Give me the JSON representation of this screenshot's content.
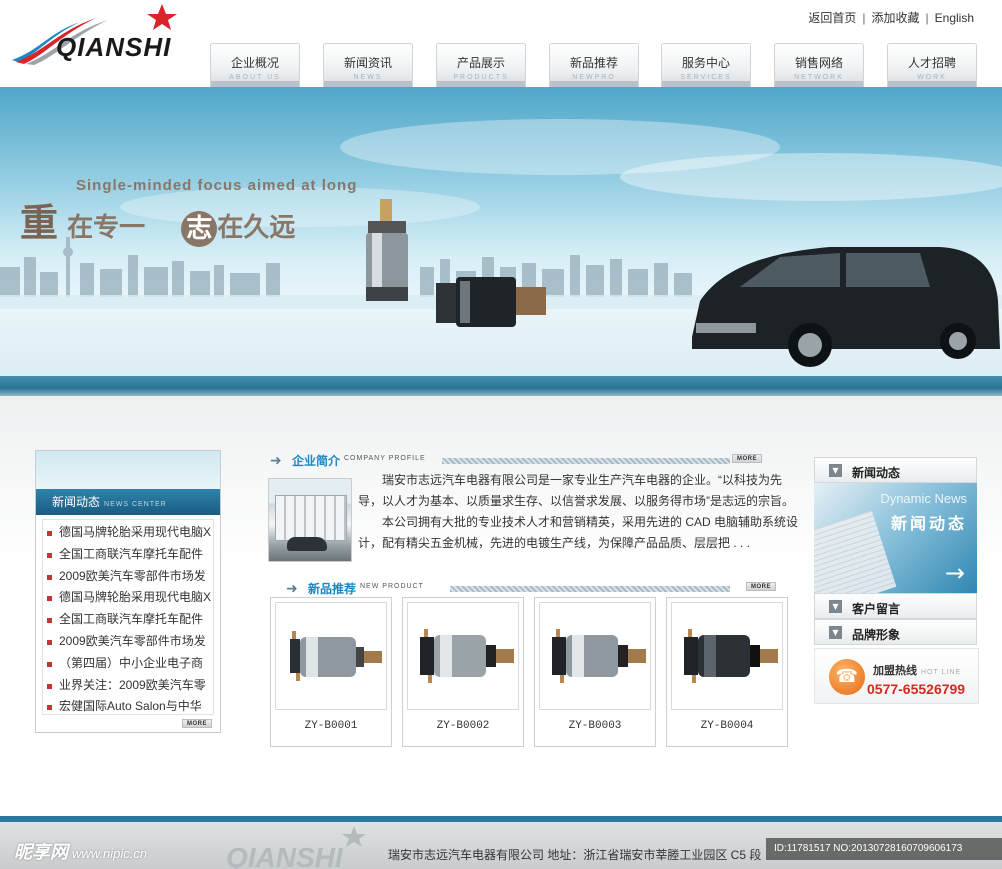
{
  "header": {
    "logo_text": "QIANSHI",
    "top_links": [
      "返回首页",
      "添加收藏",
      "English"
    ],
    "top_link_sep": "|"
  },
  "nav": [
    {
      "cn": "企业概况",
      "en": "ABOUT US"
    },
    {
      "cn": "新闻资讯",
      "en": "NEWS"
    },
    {
      "cn": "产品展示",
      "en": "PRODUCTS"
    },
    {
      "cn": "新品推荐",
      "en": "NEWPRO"
    },
    {
      "cn": "服务中心",
      "en": "SERVICES"
    },
    {
      "cn": "销售网络",
      "en": "NETWORK"
    },
    {
      "cn": "人才招聘",
      "en": "WORK"
    }
  ],
  "banner": {
    "slogan_en": "Single-minded focus aimed at long",
    "slogan_cn_1_big": "重",
    "slogan_cn_1": "在专一",
    "slogan_cn_2_big": "志",
    "slogan_cn_2": "在久远"
  },
  "news_box": {
    "title_cn": "新闻动态",
    "title_en": "NEWS CENTER",
    "items": [
      "德国马牌轮胎采用现代电脑X",
      "全国工商联汽车摩托车配件",
      "2009欧美汽车零部件市场发",
      "德国马牌轮胎采用现代电脑X",
      "全国工商联汽车摩托车配件",
      "2009欧美汽车零部件市场发",
      "（第四届）中小企业电子商",
      "业界关注：2009欧美汽车零",
      "宏健国际Auto Salon与中华"
    ],
    "more": "MORE"
  },
  "company": {
    "title_cn": "企业简介",
    "title_en": "COMPANY PROFILE",
    "more": "MORE",
    "para1": "瑞安市志远汽车电器有限公司是一家专业生产汽车电器的企业。“以科技为先导，以人才为基本、以质量求生存、以信誉求发展、以服务得市场”是志远的宗旨。",
    "para2": "本公司拥有大批的专业技术人才和营销精英，采用先进的 CAD 电脑辅助系统设计，配有精尖五金机械，先进的电镀生产线，为保障产品品质、层层把 . . ."
  },
  "new_products": {
    "title_cn": "新品推荐",
    "title_en": "NEW PRODUCT",
    "more": "MORE",
    "items": [
      "ZY-B0001",
      "ZY-B0002",
      "ZY-B0003",
      "ZY-B0004"
    ]
  },
  "right_col": {
    "news_label": "新闻动态",
    "news_pic_en": "Dynamic News",
    "news_pic_cn": "新闻动态",
    "feedback_label": "客户留言",
    "brand_label": "品牌形象",
    "hotline_label": "加盟热线",
    "hotline_en": "HOT LINE",
    "hotline_number": "0577-65526799"
  },
  "footer": {
    "address": "瑞安市志远汽车电器有限公司  地址：浙江省瑞安市莘塍工业园区 C5 段",
    "logo_ghost": "QIANSHI"
  },
  "watermark": {
    "brand": "昵享网",
    "url": "www.nipic.cn",
    "id": "ID:11781517 NO:20130728160709606173"
  },
  "colors": {
    "accent_blue": "#1c86c2",
    "nav_title_bar": "#1a5c82",
    "hotline_red": "#d42a20",
    "bullet_red": "#c83232"
  }
}
